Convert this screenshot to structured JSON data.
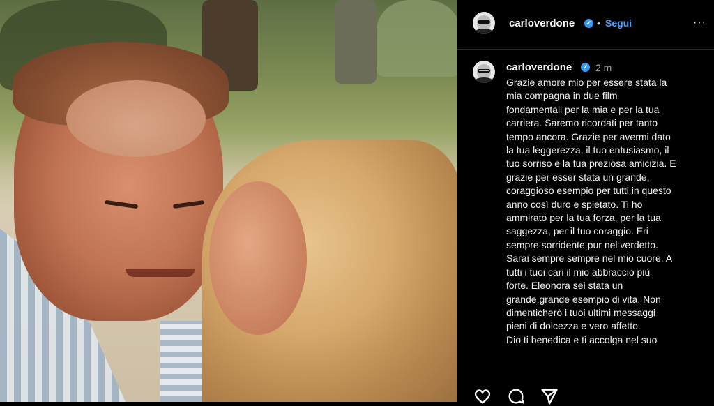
{
  "post": {
    "username": "carloverdone",
    "follow_label": "Segui",
    "separator": "•",
    "more_label": "···",
    "verified_mark": "✓"
  },
  "comment": {
    "username": "carloverdone",
    "time": "2 m",
    "caption": "Grazie amore mio per essere stata la\nmia compagna in due film\nfondamentali per la mia e per la tua\ncarriera. Saremo ricordati per tanto\ntempo ancora. Grazie per avermi dato\nla tua leggerezza, il tuo entusiasmo, il\ntuo sorriso e la tua preziosa amicizia. E\ngrazie per esser stata un grande,\ncoraggioso esempio per tutti in questo\nanno così duro e spietato. Ti ho\nammirato per la tua forza, per la tua\nsaggezza, per il tuo coraggio. Eri\nsempre sorridente pur nel verdetto.\nSarai sempre sempre nel mio cuore. A\ntutti i tuoi cari il mio abbraccio più\nforte. Eleonora sei stata un\ngrande,grande esempio di vita. Non\ndimenticherò i tuoi ultimi messaggi\npieni di dolcezza e vero affetto.\nDio ti benedica e ti accolga nel suo"
  },
  "actions": {
    "icons": [
      "heart-icon",
      "comment-icon",
      "share-icon"
    ]
  },
  "colors": {
    "link": "#4aa3ff",
    "verified": "#3897f0",
    "background": "#000000"
  }
}
